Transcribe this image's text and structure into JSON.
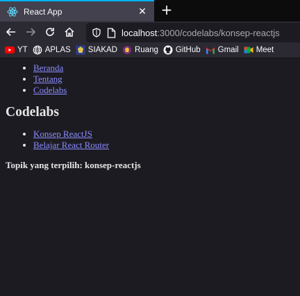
{
  "browser": {
    "tab_title": "React App",
    "url_host": "localhost",
    "url_path": ":3000/codelabs/konsep-reactjs"
  },
  "bookmarks": [
    {
      "label": "YT",
      "icon": "youtube-icon"
    },
    {
      "label": "APLAS",
      "icon": "globe-icon"
    },
    {
      "label": "SIAKAD",
      "icon": "siakad-icon"
    },
    {
      "label": "Ruang",
      "icon": "ruang-icon"
    },
    {
      "label": "GitHub",
      "icon": "github-icon"
    },
    {
      "label": "Gmail",
      "icon": "gmail-icon"
    },
    {
      "label": "Meet",
      "icon": "meet-icon"
    }
  ],
  "page": {
    "nav": [
      "Beranda",
      "Tentang",
      "Codelabs"
    ],
    "heading": "Codelabs",
    "topics": [
      "Konsep ReactJS",
      "Belajar React Router"
    ],
    "selected": "Topik yang terpilih: konsep-reactjs"
  },
  "colors": {
    "accent": "#00b3f4",
    "link": "#8c8cff",
    "page_bg": "#1c1b22"
  }
}
